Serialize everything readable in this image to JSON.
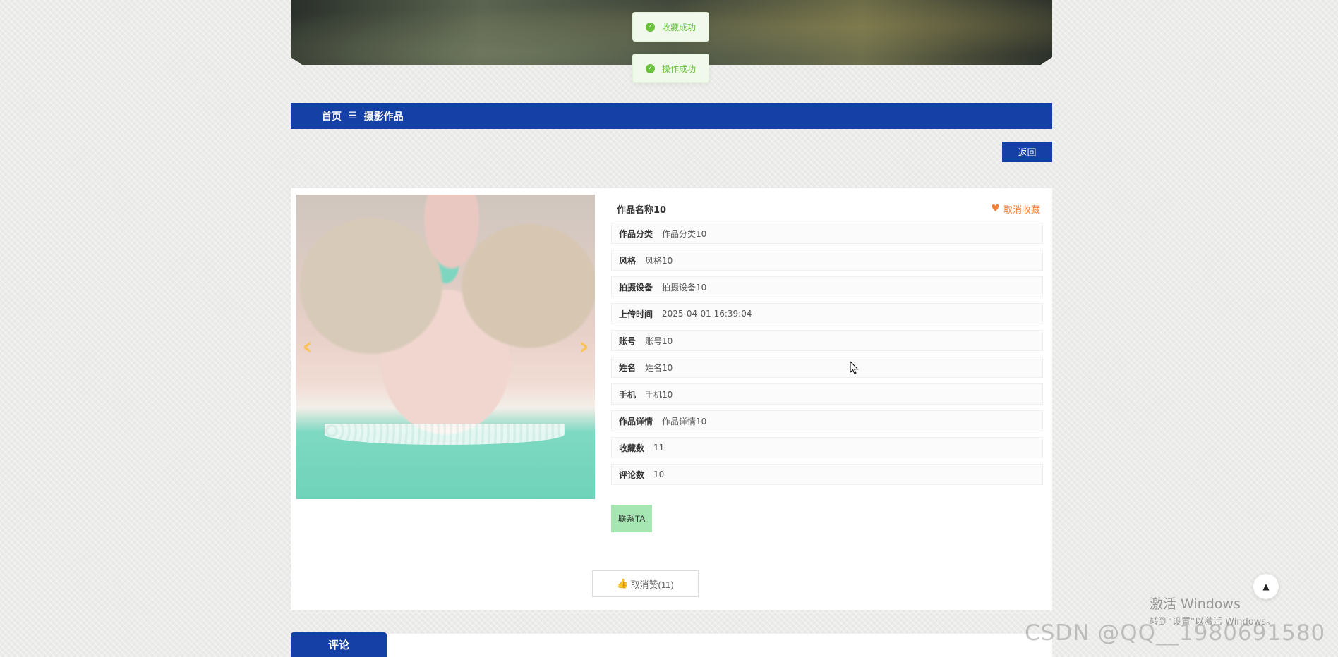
{
  "toasts": [
    {
      "text": "收藏成功"
    },
    {
      "text": "操作成功"
    }
  ],
  "breadcrumb": {
    "home": "首页",
    "separator": "☰",
    "current": "摄影作品"
  },
  "back_button": "返回",
  "detail": {
    "title": "作品名称10",
    "favorite_label": "取消收藏",
    "fields": [
      {
        "label": "作品分类",
        "value": "作品分类10"
      },
      {
        "label": "风格",
        "value": "风格10"
      },
      {
        "label": "拍摄设备",
        "value": "拍摄设备10"
      },
      {
        "label": "上传时间",
        "value": "2025-04-01 16:39:04"
      },
      {
        "label": "账号",
        "value": "账号10"
      },
      {
        "label": "姓名",
        "value": "姓名10"
      },
      {
        "label": "手机",
        "value": "手机10"
      },
      {
        "label": "作品详情",
        "value": "作品详情10"
      },
      {
        "label": "收藏数",
        "value": "11"
      },
      {
        "label": "评论数",
        "value": "10"
      }
    ],
    "contact_label": "联系TA",
    "like_label": "取消赞(11)"
  },
  "comment_tab": "评论",
  "system": {
    "win_title": "激活 Windows",
    "win_sub": "转到\"设置\"以激活 Windows。",
    "watermark": "CSDN @QQ__1980691580"
  },
  "colors": {
    "primary": "#1540a5",
    "success": "#67c23a",
    "favorite": "#f0813a",
    "contact": "#a6e6b3"
  }
}
